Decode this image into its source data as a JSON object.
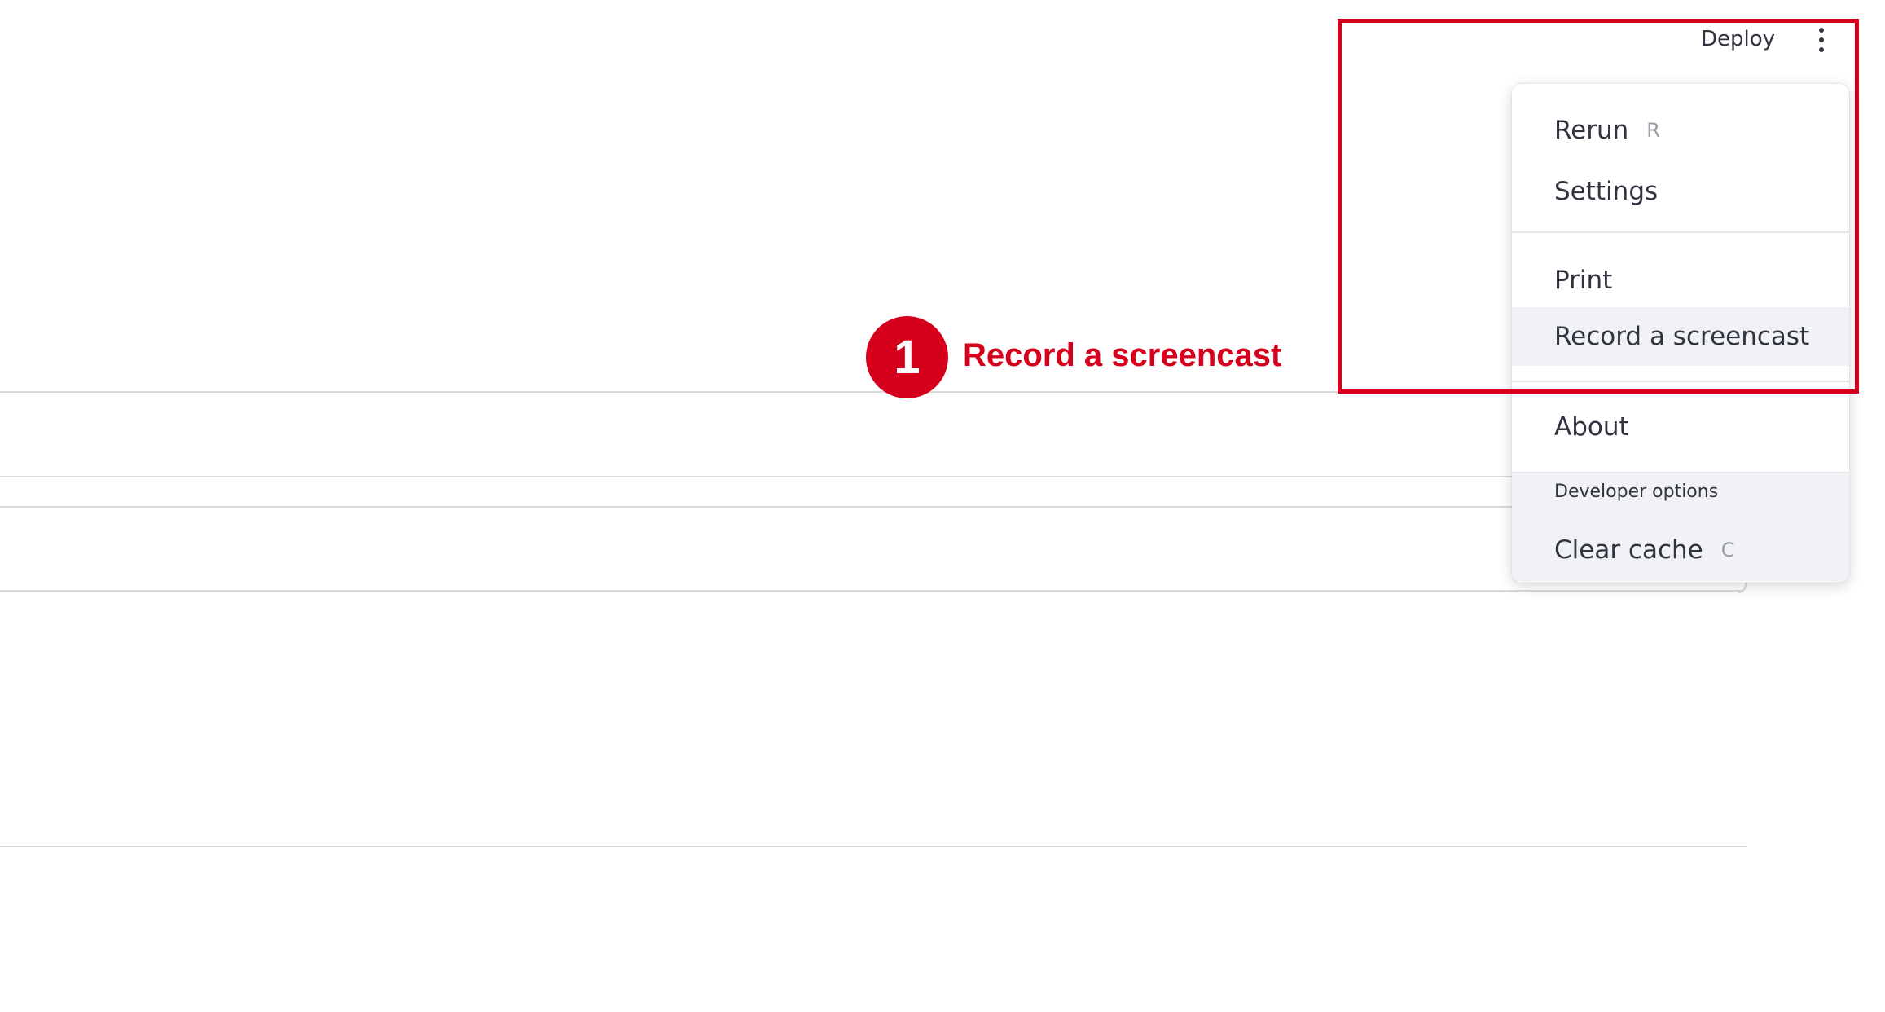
{
  "header": {
    "deploy_label": "Deploy",
    "menu_button_icon": "kebab-vertical-icon"
  },
  "menu": {
    "items": [
      {
        "label": "Rerun",
        "shortcut": "R"
      },
      {
        "label": "Settings",
        "shortcut": ""
      },
      {
        "label": "Print",
        "shortcut": ""
      },
      {
        "label": "Record a screencast",
        "shortcut": "",
        "hovered": true
      },
      {
        "label": "About",
        "shortcut": ""
      }
    ],
    "developer_section": {
      "label": "Developer options",
      "items": [
        {
          "label": "Clear cache",
          "shortcut": "C"
        }
      ]
    }
  },
  "annotation": {
    "step_number": "1",
    "step_text": "Record a screencast",
    "color": "#d6001c"
  },
  "colors": {
    "text": "#31333f",
    "hover_bg": "#f0f2f6",
    "accent": "#d6001c"
  }
}
